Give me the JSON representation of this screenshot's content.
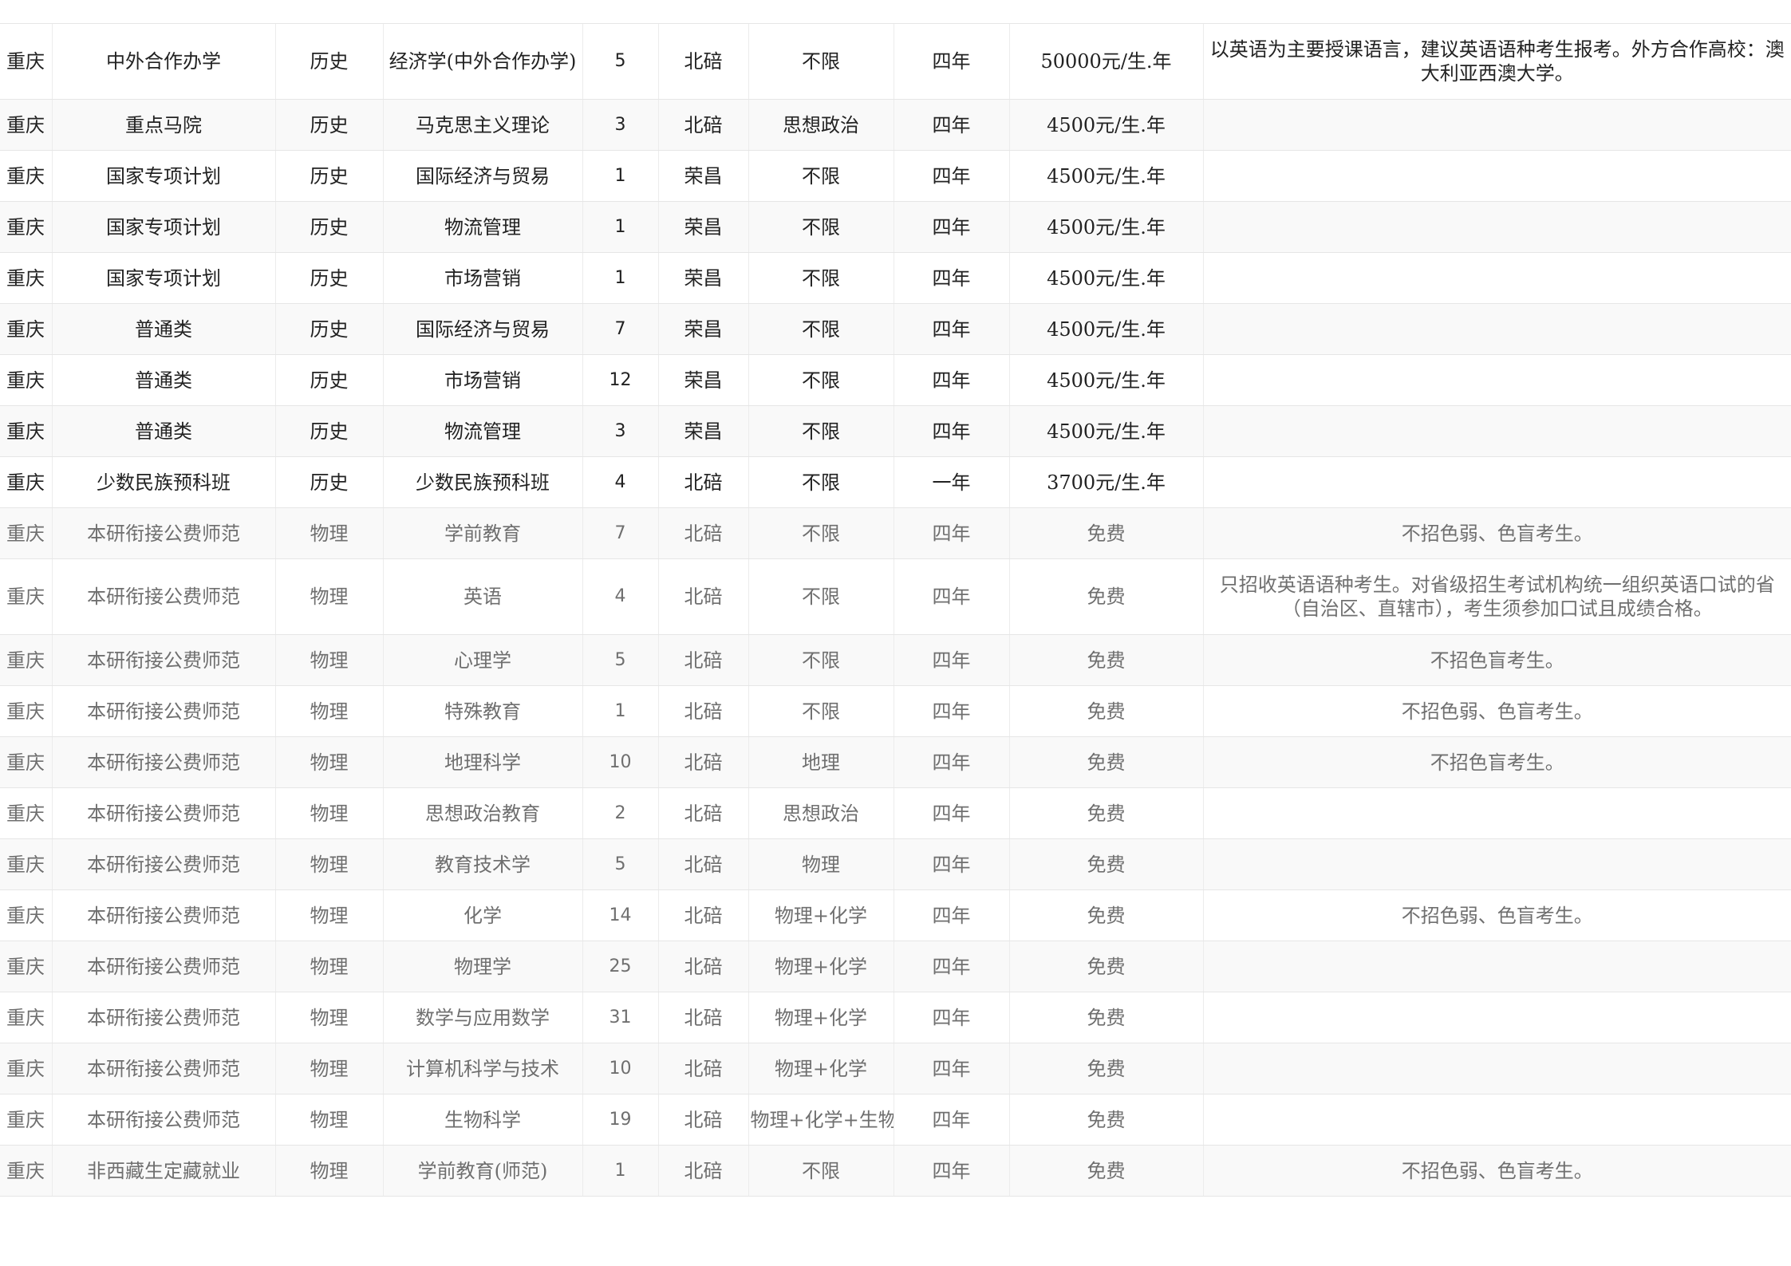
{
  "table": {
    "rows": [
      {
        "cells": [
          "重庆",
          "中外合作办学",
          "历史",
          "经济学(中外合作办学)",
          "5",
          "北碚",
          "不限",
          "四年",
          "50000元/生.年",
          "以英语为主要授课语言，建议英语语种考生报考。外方合作高校：澳大利亚西澳大学。"
        ],
        "tone": "dark"
      },
      {
        "cells": [
          "重庆",
          "重点马院",
          "历史",
          "马克思主义理论",
          "3",
          "北碚",
          "思想政治",
          "四年",
          "4500元/生.年",
          ""
        ],
        "tone": "dark"
      },
      {
        "cells": [
          "重庆",
          "国家专项计划",
          "历史",
          "国际经济与贸易",
          "1",
          "荣昌",
          "不限",
          "四年",
          "4500元/生.年",
          ""
        ],
        "tone": "dark"
      },
      {
        "cells": [
          "重庆",
          "国家专项计划",
          "历史",
          "物流管理",
          "1",
          "荣昌",
          "不限",
          "四年",
          "4500元/生.年",
          ""
        ],
        "tone": "dark"
      },
      {
        "cells": [
          "重庆",
          "国家专项计划",
          "历史",
          "市场营销",
          "1",
          "荣昌",
          "不限",
          "四年",
          "4500元/生.年",
          ""
        ],
        "tone": "dark"
      },
      {
        "cells": [
          "重庆",
          "普通类",
          "历史",
          "国际经济与贸易",
          "7",
          "荣昌",
          "不限",
          "四年",
          "4500元/生.年",
          ""
        ],
        "tone": "dark"
      },
      {
        "cells": [
          "重庆",
          "普通类",
          "历史",
          "市场营销",
          "12",
          "荣昌",
          "不限",
          "四年",
          "4500元/生.年",
          ""
        ],
        "tone": "dark"
      },
      {
        "cells": [
          "重庆",
          "普通类",
          "历史",
          "物流管理",
          "3",
          "荣昌",
          "不限",
          "四年",
          "4500元/生.年",
          ""
        ],
        "tone": "dark"
      },
      {
        "cells": [
          "重庆",
          "少数民族预科班",
          "历史",
          "少数民族预科班",
          "4",
          "北碚",
          "不限",
          "一年",
          "3700元/生.年",
          ""
        ],
        "tone": "dark"
      },
      {
        "cells": [
          "重庆",
          "本研衔接公费师范",
          "物理",
          "学前教育",
          "7",
          "北碚",
          "不限",
          "四年",
          "免费",
          "不招色弱、色盲考生。"
        ],
        "tone": "light"
      },
      {
        "cells": [
          "重庆",
          "本研衔接公费师范",
          "物理",
          "英语",
          "4",
          "北碚",
          "不限",
          "四年",
          "免费",
          "只招收英语语种考生。对省级招生考试机构统一组织英语口试的省（自治区、直辖市），考生须参加口试且成绩合格。"
        ],
        "tone": "light"
      },
      {
        "cells": [
          "重庆",
          "本研衔接公费师范",
          "物理",
          "心理学",
          "5",
          "北碚",
          "不限",
          "四年",
          "免费",
          "不招色盲考生。"
        ],
        "tone": "light"
      },
      {
        "cells": [
          "重庆",
          "本研衔接公费师范",
          "物理",
          "特殊教育",
          "1",
          "北碚",
          "不限",
          "四年",
          "免费",
          "不招色弱、色盲考生。"
        ],
        "tone": "light"
      },
      {
        "cells": [
          "重庆",
          "本研衔接公费师范",
          "物理",
          "地理科学",
          "10",
          "北碚",
          "地理",
          "四年",
          "免费",
          "不招色盲考生。"
        ],
        "tone": "light"
      },
      {
        "cells": [
          "重庆",
          "本研衔接公费师范",
          "物理",
          "思想政治教育",
          "2",
          "北碚",
          "思想政治",
          "四年",
          "免费",
          ""
        ],
        "tone": "light"
      },
      {
        "cells": [
          "重庆",
          "本研衔接公费师范",
          "物理",
          "教育技术学",
          "5",
          "北碚",
          "物理",
          "四年",
          "免费",
          ""
        ],
        "tone": "light"
      },
      {
        "cells": [
          "重庆",
          "本研衔接公费师范",
          "物理",
          "化学",
          "14",
          "北碚",
          "物理+化学",
          "四年",
          "免费",
          "不招色弱、色盲考生。"
        ],
        "tone": "light"
      },
      {
        "cells": [
          "重庆",
          "本研衔接公费师范",
          "物理",
          "物理学",
          "25",
          "北碚",
          "物理+化学",
          "四年",
          "免费",
          ""
        ],
        "tone": "light"
      },
      {
        "cells": [
          "重庆",
          "本研衔接公费师范",
          "物理",
          "数学与应用数学",
          "31",
          "北碚",
          "物理+化学",
          "四年",
          "免费",
          ""
        ],
        "tone": "light"
      },
      {
        "cells": [
          "重庆",
          "本研衔接公费师范",
          "物理",
          "计算机科学与技术",
          "10",
          "北碚",
          "物理+化学",
          "四年",
          "免费",
          ""
        ],
        "tone": "light"
      },
      {
        "cells": [
          "重庆",
          "本研衔接公费师范",
          "物理",
          "生物科学",
          "19",
          "北碚",
          "物理+化学+生物",
          "四年",
          "免费",
          ""
        ],
        "tone": "light"
      },
      {
        "cells": [
          "重庆",
          "非西藏生定藏就业",
          "物理",
          "学前教育(师范)",
          "1",
          "北碚",
          "不限",
          "四年",
          "免费",
          "不招色弱、色盲考生。"
        ],
        "tone": "light"
      }
    ]
  }
}
